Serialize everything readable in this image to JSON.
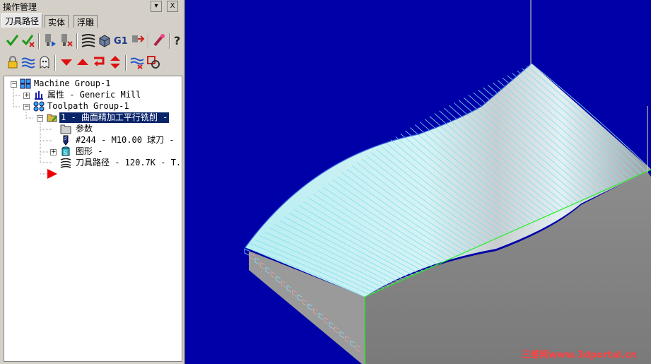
{
  "panel": {
    "title": "操作管理",
    "dropdown_symbol": "▾",
    "close_symbol": "X",
    "tabs": [
      {
        "label": "刀具路径",
        "active": true
      },
      {
        "label": "实体",
        "active": false
      },
      {
        "label": "浮雕",
        "active": false
      }
    ],
    "toolbar_row1": [
      "select-all-ops-icon",
      "regen-selected-icon",
      "verify-icon",
      "delete-op-icon",
      "toolpath-lines-icon",
      "backplot-solid-icon",
      "post-g1-icon",
      "post-output-icon",
      "highspeed-icon",
      "help-icon"
    ],
    "toolbar_row1_g1": "G1",
    "toolbar_row2": [
      "lock-icon",
      "wavy-lines-icon",
      "ghost-icon",
      "arrow-down-icon",
      "arrow-up-icon",
      "insert-arrow-icon",
      "up-down-arrow-icon",
      "waves-icon",
      "target-icon"
    ]
  },
  "tree": {
    "machine_group": "Machine Group-1",
    "properties": "属性 - Generic Mill",
    "toolpath_group": "Toolpath Group-1",
    "operation": "1 - 曲面精加工平行铣削 -",
    "params": "参数",
    "tool": "#244 - M10.00 球刀 -",
    "geometry": "图形 -",
    "toolpath": "刀具路径 - 120.7K - T."
  },
  "viewport": {
    "background": "#0000a8",
    "toolpath_color": "#7fe0f0",
    "boundary_color": "#22ee22",
    "watermark": "三维网www.3dportal.cn"
  }
}
